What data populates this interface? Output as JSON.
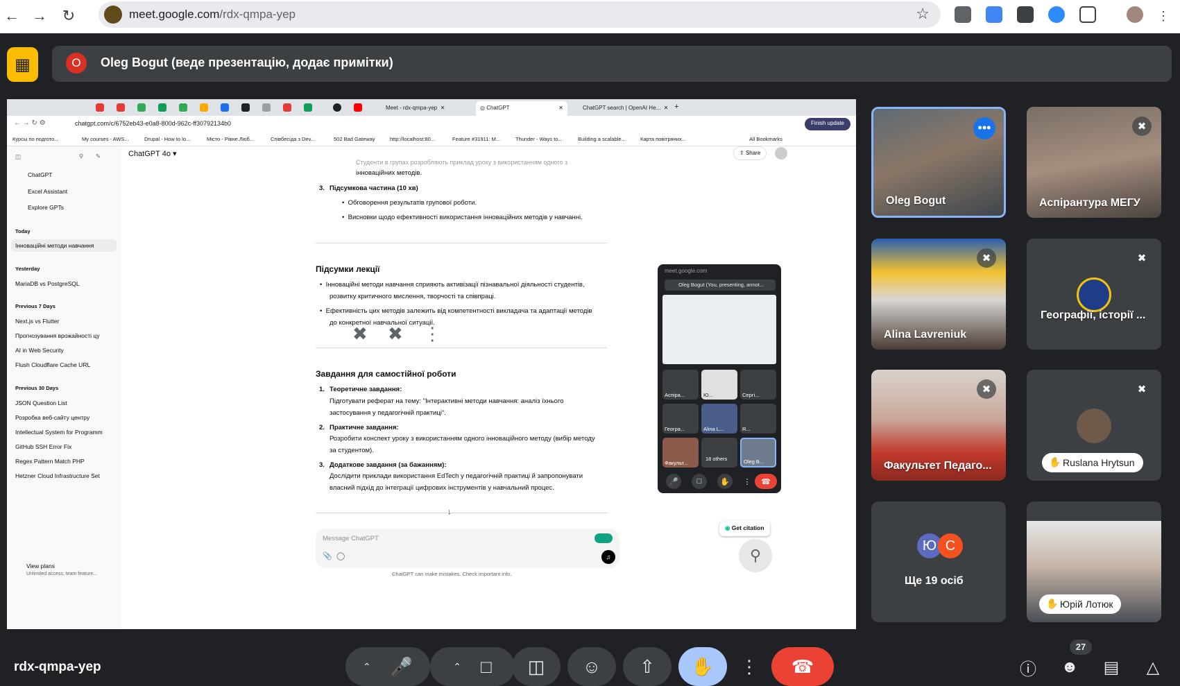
{
  "browser": {
    "url_host": "meet.google.com",
    "url_path": "/rdx-qmpa-yep",
    "back_icon": "arrow-left",
    "forward_icon": "arrow-right",
    "reload_icon": "reload",
    "extensions": [
      "google-calendar-icon",
      "google-translate-icon",
      "extension-icon",
      "zoom-extension",
      "puzzle-icon",
      "profile-avatar",
      "kebab-menu"
    ]
  },
  "meet": {
    "presenter_title": "Oleg Bogut (веде презентацію, додає примітки)",
    "presenter_initial": "O",
    "meeting_code": "rdx-qmpa-yep",
    "participant_count": "27",
    "accent": "#8ab4f8",
    "end_call_color": "#ea4335",
    "raised_hand_color": "#a8c7fa"
  },
  "shared": {
    "tabs": [
      {
        "label": "Meet - rdx-qmpa-yep"
      },
      {
        "label": "ChatGPT",
        "active": true
      },
      {
        "label": "ChatGPT search | OpenAI He..."
      }
    ],
    "address": "chatgpt.com/c/6752eb43-e0a8-800d-962c-ff30792134b0",
    "finish_update": "Finish update",
    "bookmarks": [
      "Курсы по подгото...",
      "My courses - AWS...",
      "Drupal - How to lo...",
      "Місто - Рівне.Люб...",
      "Співбесіда з Dev...",
      "502 Bad Gateway",
      "http://localhost:80...",
      "Feature #31911: M...",
      "Thunder - Ways to...",
      "Building a scalable...",
      "Карта повітряних..."
    ],
    "all_bookmarks": "All Bookmarks",
    "sidebar": {
      "top": [
        "ChatGPT",
        "Excel Assistant",
        "Explore GPTs"
      ],
      "today_h": "Today",
      "today": [
        "Інноваційні методи навчання"
      ],
      "yesterday_h": "Yesterday",
      "yesterday": [
        "MariaDB vs PostgreSQL"
      ],
      "prev7_h": "Previous 7 Days",
      "prev7": [
        "Next.js vs Flutter",
        "Прогнозування врожайності цу",
        "AI in Web Security",
        "Flush Cloudflare Cache URL"
      ],
      "prev30_h": "Previous 30 Days",
      "prev30": [
        "JSON Question List",
        "Розробка веб-сайту центру",
        "Intellectual System for Programm",
        "GitHub SSH Error Fix",
        "Regex Pattern Match PHP",
        "Hetzner Cloud Infrastructure Set"
      ],
      "view_plans": "View plans",
      "view_plans_sub": "Unlimited access, team feature..."
    },
    "model": "ChatGPT 4o",
    "share": "Share",
    "content": {
      "l0": "Студенти в групах розробляють приклад уроку з використанням одного з",
      "l1": "інноваційних методів.",
      "s3n": "3.",
      "s3": "Підсумкова частина (10 хв)",
      "s3a": "Обговорення результатів групової роботи.",
      "s3b": "Висновки щодо ефективності використання інноваційних методів у навчанні.",
      "h1": "Підсумки лекції",
      "p1a": "Інноваційні методи навчання сприяють активізації пізнавальної діяльності студентів,",
      "p1b": "розвитку критичного мислення, творчості та співпраці.",
      "p2a": "Ефективність цих методів залежить від компетентності викладача та адаптації методів",
      "p2b": "до конкретної навчальної ситуації.",
      "h2": "Завдання для самостійної роботи",
      "t1n": "1.",
      "t1": "Теоретичне завдання:",
      "t1a": "Підготувати реферат на тему: \"Інтерактивні методи навчання: аналіз їхнього",
      "t1b": "застосування у педагогічній практиці\".",
      "t2n": "2.",
      "t2": "Практичне завдання:",
      "t2a": "Розробити конспект уроку з використанням одного інноваційного методу (вибір методу",
      "t2b": "за студентом).",
      "t3n": "3.",
      "t3": "Додаткове завдання (за бажанням):",
      "t3a": "Дослідити приклади використання EdTech у педагогічній практиці й запропонувати",
      "t3b": "власний підхід до інтеграції цифрових інструментів у навчальний процес."
    },
    "message_placeholder": "Message ChatGPT",
    "disclaimer": "ChatGPT can make mistakes. Check important info.",
    "get_citation": "Get citation",
    "popup": {
      "host": "meet.google.com",
      "title": "Oleg Bogut (You, presenting, annot...",
      "tiles": [
        "Аспіра...",
        "Ю...",
        "Сергі...",
        "Геогра...",
        "Alina L...",
        "R...",
        "Факульт...",
        "18 others",
        "Oleg B..."
      ]
    }
  },
  "tiles": [
    {
      "name": "Oleg Bogut",
      "active": true
    },
    {
      "name": "Аспірантура МЕГУ",
      "muted": true
    },
    {
      "name": "Alina Lavreniuk",
      "muted": true
    },
    {
      "name": "Географії, історії ...",
      "muted": true
    },
    {
      "name": "Факультет Педаго...",
      "muted": true
    },
    {
      "name": "Ruslana Hrytsun",
      "muted": true,
      "hand": true
    },
    {
      "name": "Ще 19 осіб",
      "initials": [
        "Ю",
        "С"
      ]
    },
    {
      "name": "Юрій Лотюк",
      "hand": true
    }
  ]
}
